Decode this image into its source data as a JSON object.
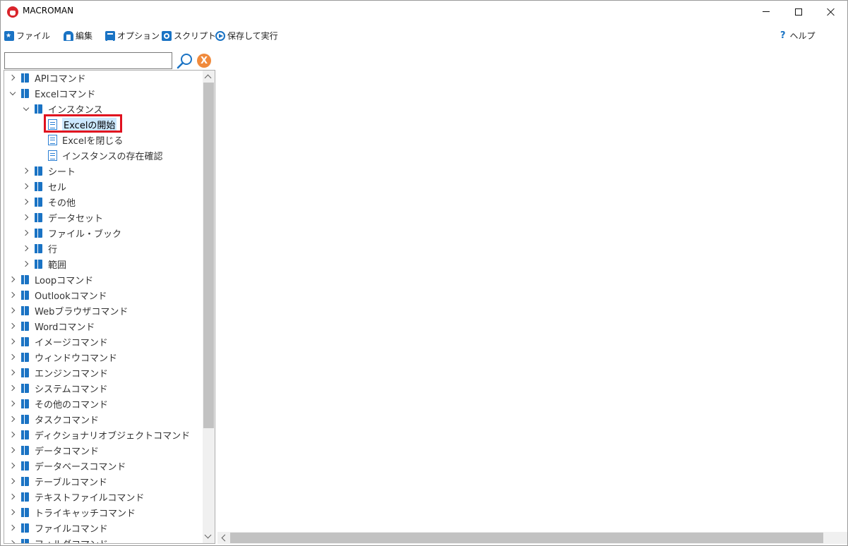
{
  "window": {
    "title": "MACROMAN"
  },
  "menu": {
    "file": "ファイル",
    "edit": "編集",
    "option": "オプション",
    "script": "スクリプト",
    "save_run": "保存して実行",
    "help": "ヘルプ"
  },
  "search": {
    "value": "",
    "placeholder": "",
    "clear_label": "X"
  },
  "tree": {
    "items": [
      {
        "label": "APIコマンド",
        "level": 0,
        "expand": "collapsed",
        "icon": "book-icon"
      },
      {
        "label": "Excelコマンド",
        "level": 0,
        "expand": "expanded",
        "icon": "book-icon"
      },
      {
        "label": "インスタンス",
        "level": 1,
        "expand": "expanded",
        "icon": "book-icon"
      },
      {
        "label": "Excelの開始",
        "level": 2,
        "expand": "none",
        "icon": "doc-icon",
        "selected": true
      },
      {
        "label": "Excelを閉じる",
        "level": 2,
        "expand": "none",
        "icon": "doc-icon"
      },
      {
        "label": "インスタンスの存在確認",
        "level": 2,
        "expand": "none",
        "icon": "doc-icon"
      },
      {
        "label": "シート",
        "level": 1,
        "expand": "collapsed",
        "icon": "book-icon"
      },
      {
        "label": "セル",
        "level": 1,
        "expand": "collapsed",
        "icon": "book-icon"
      },
      {
        "label": "その他",
        "level": 1,
        "expand": "collapsed",
        "icon": "book-icon"
      },
      {
        "label": "データセット",
        "level": 1,
        "expand": "collapsed",
        "icon": "book-icon"
      },
      {
        "label": "ファイル・ブック",
        "level": 1,
        "expand": "collapsed",
        "icon": "book-icon"
      },
      {
        "label": "行",
        "level": 1,
        "expand": "collapsed",
        "icon": "book-icon"
      },
      {
        "label": "範囲",
        "level": 1,
        "expand": "collapsed",
        "icon": "book-icon"
      },
      {
        "label": "Loopコマンド",
        "level": 0,
        "expand": "collapsed",
        "icon": "book-icon"
      },
      {
        "label": "Outlookコマンド",
        "level": 0,
        "expand": "collapsed",
        "icon": "book-icon"
      },
      {
        "label": "Webブラウザコマンド",
        "level": 0,
        "expand": "collapsed",
        "icon": "book-icon"
      },
      {
        "label": "Wordコマンド",
        "level": 0,
        "expand": "collapsed",
        "icon": "book-icon"
      },
      {
        "label": "イメージコマンド",
        "level": 0,
        "expand": "collapsed",
        "icon": "book-icon"
      },
      {
        "label": "ウィンドウコマンド",
        "level": 0,
        "expand": "collapsed",
        "icon": "book-icon"
      },
      {
        "label": "エンジンコマンド",
        "level": 0,
        "expand": "collapsed",
        "icon": "book-icon"
      },
      {
        "label": "システムコマンド",
        "level": 0,
        "expand": "collapsed",
        "icon": "book-icon"
      },
      {
        "label": "その他のコマンド",
        "level": 0,
        "expand": "collapsed",
        "icon": "book-icon"
      },
      {
        "label": "タスクコマンド",
        "level": 0,
        "expand": "collapsed",
        "icon": "book-icon"
      },
      {
        "label": "ディクショナリオブジェクトコマンド",
        "level": 0,
        "expand": "collapsed",
        "icon": "book-icon"
      },
      {
        "label": "データコマンド",
        "level": 0,
        "expand": "collapsed",
        "icon": "book-icon"
      },
      {
        "label": "データベースコマンド",
        "level": 0,
        "expand": "collapsed",
        "icon": "book-icon"
      },
      {
        "label": "テーブルコマンド",
        "level": 0,
        "expand": "collapsed",
        "icon": "book-icon"
      },
      {
        "label": "テキストファイルコマンド",
        "level": 0,
        "expand": "collapsed",
        "icon": "book-icon"
      },
      {
        "label": "トライキャッチコマンド",
        "level": 0,
        "expand": "collapsed",
        "icon": "book-icon"
      },
      {
        "label": "ファイルコマンド",
        "level": 0,
        "expand": "collapsed",
        "icon": "book-icon"
      },
      {
        "label": "フォルダコマンド",
        "level": 0,
        "expand": "collapsed",
        "icon": "book-icon"
      }
    ]
  },
  "colors": {
    "accent": "#1a73c4",
    "highlight_border": "#e0111f",
    "clear_button": "#f08a3c"
  }
}
